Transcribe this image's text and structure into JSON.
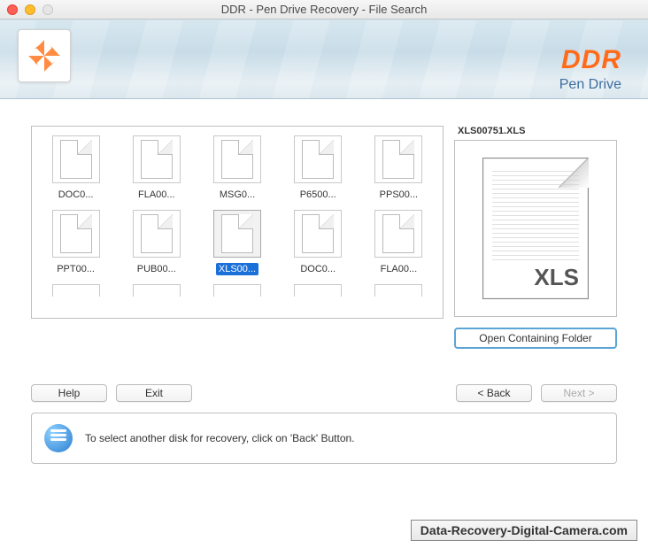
{
  "window": {
    "title": "DDR - Pen Drive Recovery - File Search"
  },
  "brand": {
    "name": "DDR",
    "product": "Pen Drive"
  },
  "files": {
    "row1": [
      "DOC0...",
      "FLA00...",
      "MSG0...",
      "P6500...",
      "PPS00..."
    ],
    "row2": [
      "PPT00...",
      "PUB00...",
      "XLS00...",
      "DOC0...",
      "FLA00..."
    ],
    "selected_index": 2
  },
  "preview": {
    "filename": "XLS00751.XLS",
    "ext": "XLS"
  },
  "buttons": {
    "open_folder": "Open Containing Folder",
    "help": "Help",
    "exit": "Exit",
    "back": "< Back",
    "next": "Next >"
  },
  "hint": "To select another disk for recovery, click on 'Back' Button.",
  "watermark": "Data-Recovery-Digital-Camera.com"
}
